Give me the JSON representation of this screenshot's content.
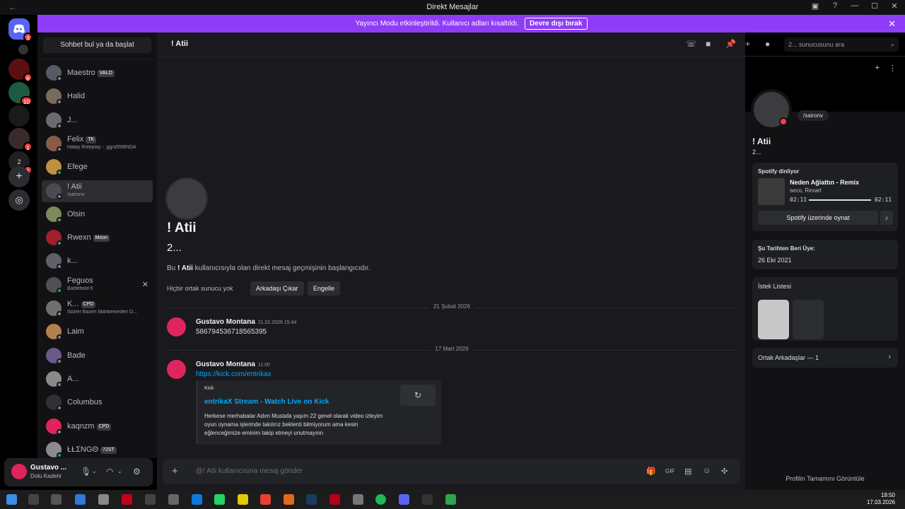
{
  "window": {
    "title": "Direkt Mesajlar"
  },
  "banner": {
    "text": "Yayıncı Modu etkinleştirildi. Kullanıcı adları kısaltıldı.",
    "button": "Devre dışı bırak"
  },
  "rail": {
    "badges": [
      "3",
      "6",
      "10",
      "1",
      "1"
    ],
    "labels": [
      "2",
      "≠"
    ]
  },
  "sidebar": {
    "search_label": "Sohbet bul ya da başlat",
    "dms": [
      {
        "name": "Maestro",
        "tag": "VALO",
        "sub": "",
        "online": false
      },
      {
        "name": "Halid",
        "tag": "",
        "sub": "",
        "online": false
      },
      {
        "name": "J...",
        "tag": "",
        "sub": "",
        "online": false
      },
      {
        "name": "Felix",
        "tag": "TK",
        "sub": "Hatay Roleplay - .gg/a55f8NDA",
        "online": false
      },
      {
        "name": "Efege",
        "tag": "",
        "sub": "",
        "online": true
      },
      {
        "name": "! Atii",
        "tag": "",
        "sub": "/saironv",
        "online": false
      },
      {
        "name": "Olsin",
        "tag": "",
        "sub": "",
        "online": false
      },
      {
        "name": "Rwexn",
        "tag": "Moon",
        "sub": "",
        "online": true
      },
      {
        "name": "k...",
        "tag": "",
        "sub": "",
        "online": false
      },
      {
        "name": "Feguos",
        "tag": "",
        "sub": "Battlefield 6",
        "online": true
      },
      {
        "name": "K...",
        "tag": "CPD",
        "sub": "Sözler Bazen Mahkemeden D...",
        "online": false
      },
      {
        "name": "Laim",
        "tag": "",
        "sub": "",
        "online": false
      },
      {
        "name": "Bade",
        "tag": "",
        "sub": "",
        "online": false
      },
      {
        "name": "A...",
        "tag": "",
        "sub": "",
        "online": false
      },
      {
        "name": "Columbus",
        "tag": "",
        "sub": "",
        "online": false
      },
      {
        "name": "kaqnzm",
        "tag": "CPD",
        "sub": "",
        "online": false
      },
      {
        "name": "ŁŁΣNGΘ",
        "tag": "72ST",
        "sub": "",
        "online": true
      }
    ]
  },
  "user": {
    "name": "Gustavo ...",
    "status": "Dolu Kadehi"
  },
  "chat": {
    "header_name": "! Atii",
    "search_placeholder": "2... sunucusunu ara",
    "profile_name": "! Atii",
    "profile_sub": "2...",
    "intro_pre": "Bu ",
    "intro_name": "! Atii",
    "intro_post": " kullanıcısıyla olan direkt mesaj geçmişinin başlangıcıdır.",
    "no_mutual": "Hiçbir ortak sunucu yok",
    "remove_friend": "Arkadaşı Çıkar",
    "block": "Engelle",
    "date1": "21 Şubat 2026",
    "date2": "17 Mart 2026",
    "messages": [
      {
        "author": "Gustavo Montana",
        "time": "21.02.2026 15:44",
        "text": "586794536718565395"
      },
      {
        "author": "Gustavo Montana",
        "time": "11:00",
        "text": "https://kick.com/entrikax"
      }
    ],
    "embed": {
      "provider": "Kick",
      "title": "entrikaX Stream - Watch Live on Kick",
      "description": "Herkese merhabalar Adım Mustafa yaşım 22 genel olarak video izleyim oyun oynama işlerinde takılırız beklenti bilmiyorum ama kesin eğlenceğimize eminim takip etmeyi unutmayınn"
    },
    "composer_placeholder": "@! Atii kullanıcısına mesaj gönder"
  },
  "profile": {
    "note": "/saironv",
    "name": "! Atii",
    "sub": "2...",
    "spotify_label": "Spotify dinliyor",
    "track": "Neden Ağlattın - Remix",
    "artist": "seco, Rexart",
    "elapsed": "02:11",
    "duration": "02:11",
    "play_button": "Spotify üzerinde oynat",
    "member_since_label": "Şu Tarihten Beri Üye:",
    "member_since": "26 Eki 2021",
    "wishlist_label": "İstek Listesi",
    "mutual_friends": "Ortak Arkadaşlar — 1",
    "view_full": "Profilin Tamamını Görüntüle"
  },
  "taskbar": {
    "time": "19:50",
    "date": "17.03.2026"
  },
  "colors": {
    "banner": "#8f3cf7",
    "blurple": "#5865f2",
    "link": "#00a8fc",
    "online": "#23a55a",
    "dnd": "#f23f43"
  }
}
